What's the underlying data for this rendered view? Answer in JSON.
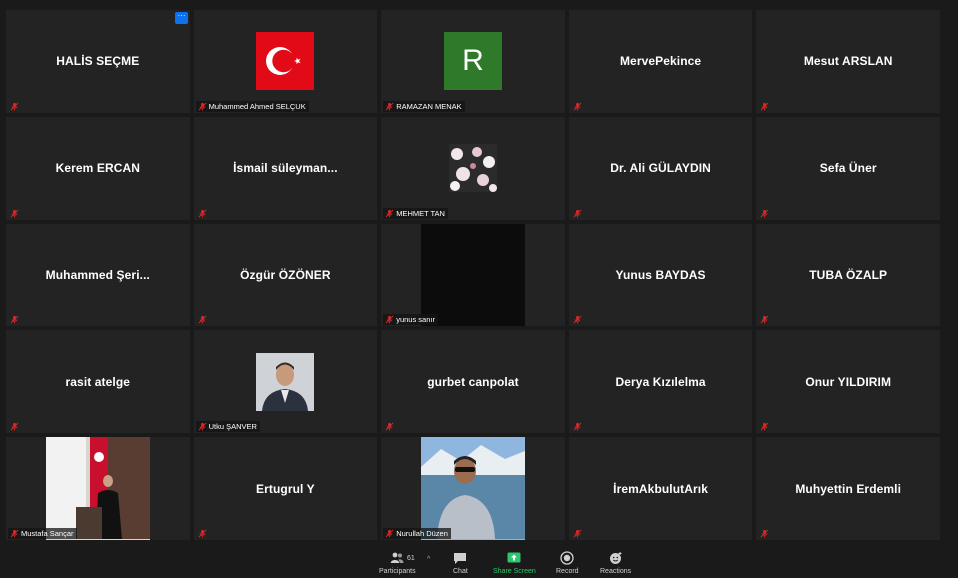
{
  "meeting": {
    "participants": [
      {
        "name": "HALİS SEÇME",
        "kind": "name",
        "footer": ""
      },
      {
        "name": "",
        "kind": "flag",
        "footer": "Muhammed Ahmed SELÇUK"
      },
      {
        "name": "R",
        "kind": "letter",
        "footer": "RAMAZAN MENAK"
      },
      {
        "name": "MervePekince",
        "kind": "name",
        "footer": ""
      },
      {
        "name": "Mesut ARSLAN",
        "kind": "name",
        "footer": ""
      },
      {
        "name": "Kerem ERCAN",
        "kind": "name",
        "footer": ""
      },
      {
        "name": "İsmail  süleyman...",
        "kind": "name",
        "footer": ""
      },
      {
        "name": "",
        "kind": "flowers",
        "footer": "MEHMET TAN"
      },
      {
        "name": "Dr. Ali GÜLAYDIN",
        "kind": "name",
        "footer": ""
      },
      {
        "name": "Sefa Üner",
        "kind": "name",
        "footer": ""
      },
      {
        "name": "Muhammed  Şeri...",
        "kind": "name",
        "footer": ""
      },
      {
        "name": "Özgür ÖZÖNER",
        "kind": "name",
        "footer": ""
      },
      {
        "name": "",
        "kind": "video-black",
        "footer": "yunus sanır"
      },
      {
        "name": "Yunus BAYDAS",
        "kind": "name",
        "footer": ""
      },
      {
        "name": "TUBA ÖZALP",
        "kind": "name",
        "footer": ""
      },
      {
        "name": "rasit atelge",
        "kind": "name",
        "footer": ""
      },
      {
        "name": "",
        "kind": "photo-utku",
        "footer": "Utku ŞANVER"
      },
      {
        "name": "gurbet canpolat",
        "kind": "name",
        "footer": ""
      },
      {
        "name": "Derya Kızılelma",
        "kind": "name",
        "footer": ""
      },
      {
        "name": "Onur YILDIRIM",
        "kind": "name",
        "footer": ""
      },
      {
        "name": "",
        "kind": "video-mustafa",
        "footer": "Mustafa Sançar"
      },
      {
        "name": "Ertugrul Y",
        "kind": "name",
        "footer": ""
      },
      {
        "name": "",
        "kind": "video-nurullah",
        "footer": "Nurullah Düzen"
      },
      {
        "name": "İremAkbulutArık",
        "kind": "name",
        "footer": ""
      },
      {
        "name": "Muhyettin Erdemli",
        "kind": "name",
        "footer": ""
      }
    ]
  },
  "more_button": {
    "label": "···"
  },
  "toolbar": {
    "participants_count": "61",
    "participants_label": "Participants",
    "chat_label": "Chat",
    "share_label": "Share Screen",
    "record_label": "Record",
    "reactions_label": "Reactions",
    "caret": "^"
  },
  "colors": {
    "muted_mic": "#e02828",
    "share_accent": "#2fc56d",
    "more_button": "#0e72ed",
    "tile_bg": "#232323"
  }
}
